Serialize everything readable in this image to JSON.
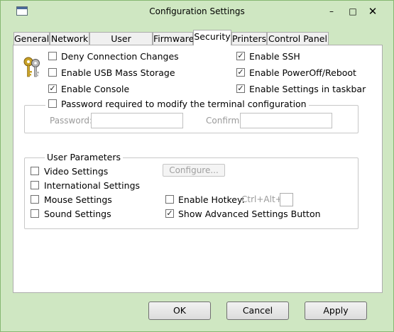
{
  "window": {
    "title": "Configuration Settings",
    "controls": {
      "minimize": "–",
      "maximize": "□",
      "close": "✕"
    }
  },
  "tabs": [
    {
      "label": "General",
      "active": false
    },
    {
      "label": "Network",
      "active": false
    },
    {
      "label": "User Interface",
      "active": false
    },
    {
      "label": "Firmware",
      "active": false
    },
    {
      "label": "Security",
      "active": true
    },
    {
      "label": "Printers",
      "active": false
    },
    {
      "label": "Control Panel",
      "active": false
    }
  ],
  "security": {
    "left_options": [
      {
        "label": "Deny Connection Changes",
        "checked": false
      },
      {
        "label": "Enable USB Mass Storage",
        "checked": false
      },
      {
        "label": "Enable Console",
        "checked": true
      }
    ],
    "right_options": [
      {
        "label": "Enable SSH",
        "checked": true
      },
      {
        "label": "Enable PowerOff/Reboot",
        "checked": true
      },
      {
        "label": "Enable Settings in taskbar",
        "checked": true
      }
    ],
    "password_group": {
      "label": "Password required to modify the terminal configuration",
      "checked": false,
      "password_label": "Password:",
      "password_value": "",
      "confirm_label": "Confirm:",
      "confirm_value": ""
    },
    "user_parameters": {
      "title": "User Parameters",
      "video": {
        "label": "Video Settings",
        "checked": false
      },
      "international": {
        "label": "International Settings",
        "checked": false
      },
      "mouse": {
        "label": "Mouse Settings",
        "checked": false
      },
      "sound": {
        "label": "Sound Settings",
        "checked": false
      },
      "configure_label": "Configure...",
      "hotkey": {
        "label": "Enable Hotkey:",
        "checked": false,
        "prefix": "Ctrl+Alt+",
        "value": ""
      },
      "advanced": {
        "label": "Show Advanced Settings Button",
        "checked": true
      }
    }
  },
  "buttons": {
    "ok": "OK",
    "cancel": "Cancel",
    "apply": "Apply"
  },
  "colors": {
    "desktop": "#6fd34b",
    "window_bg": "#cfe7c2",
    "panel_bg": "#ffffff"
  }
}
